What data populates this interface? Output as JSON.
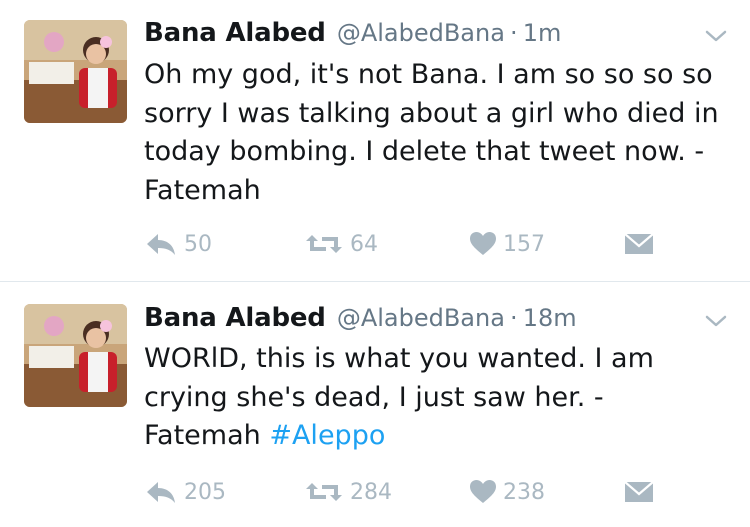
{
  "colors": {
    "name": "#14171a",
    "secondary": "#657786",
    "action_gray": "#aab8c2",
    "hashtag": "#1da1f2",
    "divider": "#e1e8ed"
  },
  "tweets": [
    {
      "author_name": "Bana Alabed",
      "handle": "@AlabedBana",
      "separator": "·",
      "time": "1m",
      "text": "Oh my god, it's not Bana. I am so so so so sorry I was talking about a girl who died in today bombing. I delete that tweet now. - Fatemah",
      "hashtag": "",
      "replies": "50",
      "retweets": "64",
      "likes": "157",
      "icons": [
        "reply-icon",
        "retweet-icon",
        "heart-icon",
        "envelope-icon",
        "chevron-down-icon"
      ]
    },
    {
      "author_name": "Bana Alabed",
      "handle": "@AlabedBana",
      "separator": "·",
      "time": "18m",
      "text": "WORlD, this is what you wanted. I am crying she's dead, I just saw her. - Fatemah ",
      "hashtag": "#Aleppo",
      "replies": "205",
      "retweets": "284",
      "likes": "238",
      "icons": [
        "reply-icon",
        "retweet-icon",
        "heart-icon",
        "envelope-icon",
        "chevron-down-icon"
      ]
    }
  ]
}
